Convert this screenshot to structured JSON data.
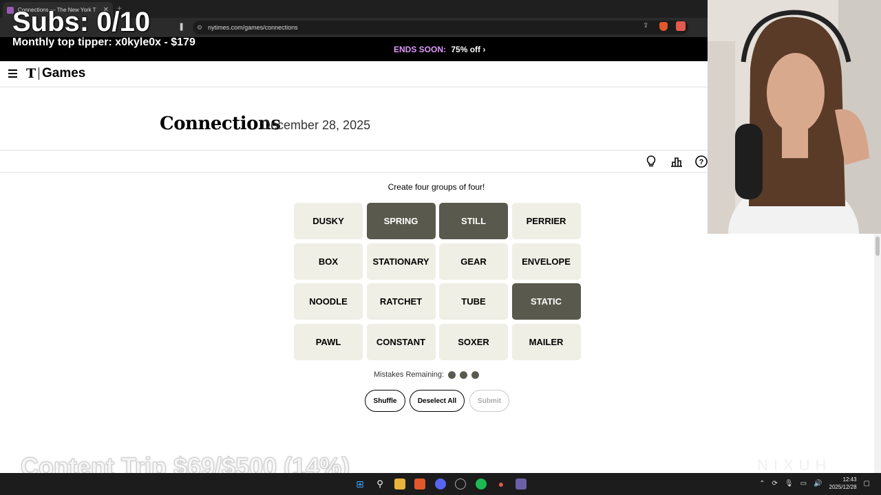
{
  "browser": {
    "tab_title": "Connections — The New York T",
    "url": "nytimes.com/games/connections"
  },
  "overlay": {
    "subs": "Subs: 0/10",
    "top_tipper": "Monthly top tipper: x0kyle0x - $179",
    "goal": "Content Trip $69/$500 (14%)",
    "sponsor": "NIXUH"
  },
  "promo": {
    "ends_label": "ENDS SOON:",
    "offer": "75% off ›"
  },
  "header": {
    "logo": "T",
    "brand": "Games"
  },
  "game": {
    "title": "Connections",
    "date": "December 28, 2025",
    "prompt": "Create four groups of four!",
    "tiles": [
      {
        "word": "DUSKY",
        "selected": false
      },
      {
        "word": "SPRING",
        "selected": true
      },
      {
        "word": "STILL",
        "selected": true
      },
      {
        "word": "PERRIER",
        "selected": false
      },
      {
        "word": "BOX",
        "selected": false
      },
      {
        "word": "STATIONARY",
        "selected": false
      },
      {
        "word": "GEAR",
        "selected": false
      },
      {
        "word": "ENVELOPE",
        "selected": false
      },
      {
        "word": "NOODLE",
        "selected": false
      },
      {
        "word": "RATCHET",
        "selected": false
      },
      {
        "word": "TUBE",
        "selected": false
      },
      {
        "word": "STATIC",
        "selected": true
      },
      {
        "word": "PAWL",
        "selected": false
      },
      {
        "word": "CONSTANT",
        "selected": false
      },
      {
        "word": "SOXER",
        "selected": false
      },
      {
        "word": "MAILER",
        "selected": false
      }
    ],
    "mistakes_label": "Mistakes Remaining:",
    "mistakes_remaining": 3,
    "buttons": {
      "shuffle": "Shuffle",
      "deselect": "Deselect All",
      "submit": "Submit"
    }
  },
  "taskbar": {
    "time": "12:43",
    "date": "2025/12/28"
  },
  "colors": {
    "tile_bg": "#efefe6",
    "tile_selected": "#5a594e",
    "promo_accent": "#e199ff"
  }
}
